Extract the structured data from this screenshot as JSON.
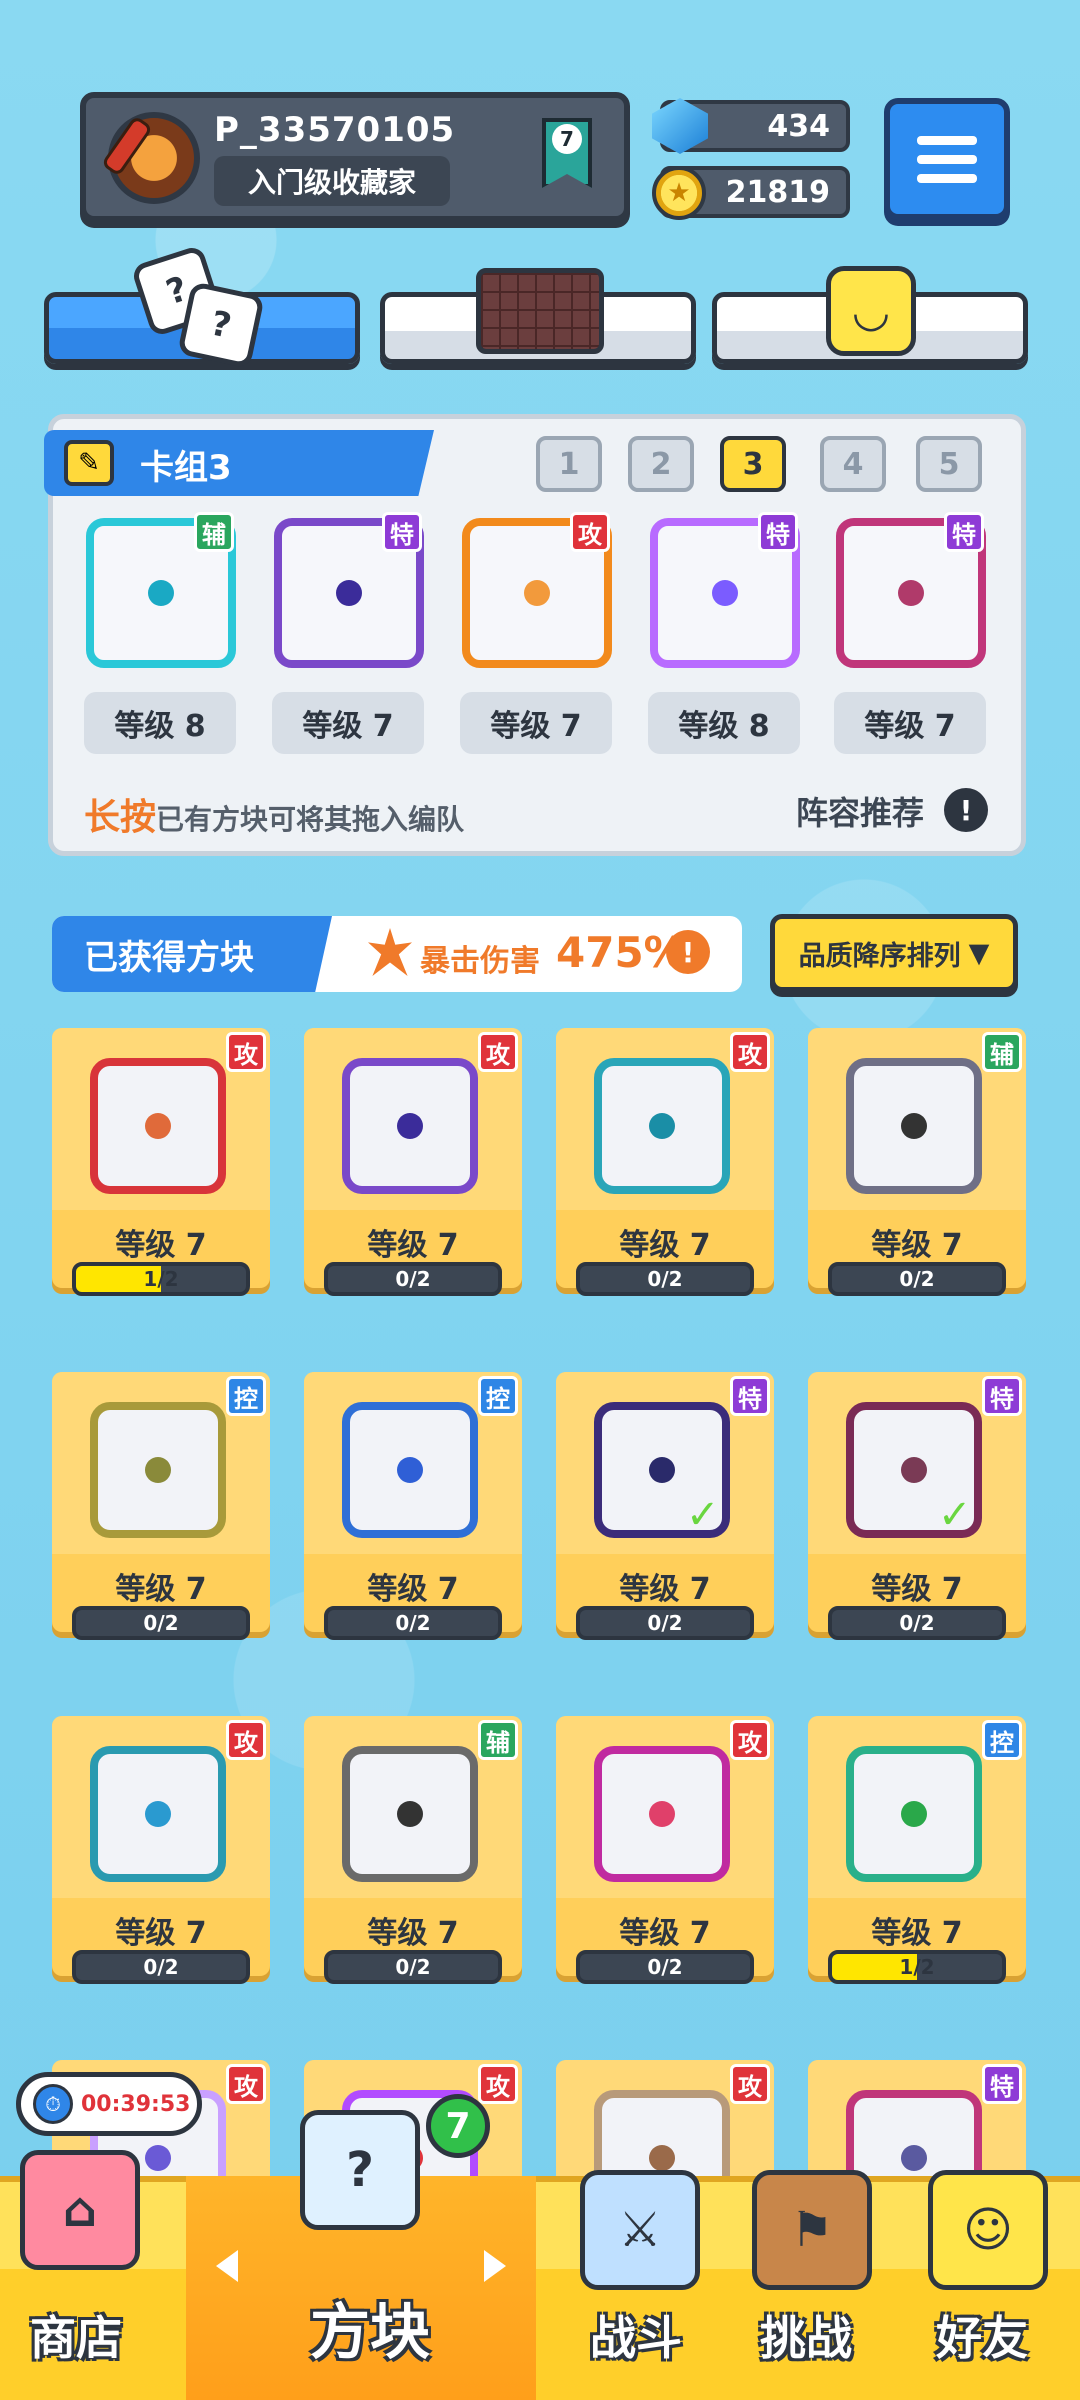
{
  "player": {
    "id": "P_33570105",
    "title": "入门级收藏家",
    "rank": "7"
  },
  "currency": {
    "gems": "434",
    "coins": "21819"
  },
  "deck": {
    "title": "卡组3",
    "numbers": [
      "1",
      "2",
      "3",
      "4",
      "5"
    ],
    "active_number": "3",
    "cards": [
      {
        "tag": "辅",
        "tag_type": "fu",
        "level": "等级 8",
        "color": "#2ac8d8",
        "dot": "#1aa9c4"
      },
      {
        "tag": "特",
        "tag_type": "te",
        "level": "等级 7",
        "color": "#7a49c9",
        "dot": "#3b2c9a"
      },
      {
        "tag": "攻",
        "tag_type": "gong",
        "level": "等级 7",
        "color": "#f28a1c",
        "dot": "#f29a3c"
      },
      {
        "tag": "特",
        "tag_type": "te",
        "level": "等级 8",
        "color": "#b86bff",
        "dot": "#7b5cff"
      },
      {
        "tag": "特",
        "tag_type": "te",
        "level": "等级 7",
        "color": "#c0367a",
        "dot": "#b03a6a"
      }
    ],
    "hint_emphasis": "长按",
    "hint_text": "已有方块可将其拖入编队",
    "lineup_label": "阵容推荐",
    "info_symbol": "!"
  },
  "owned": {
    "title": "已获得方块",
    "crit_label": "暴击伤害",
    "crit_value": "475%",
    "crit_info": "!",
    "sort_label": "品质降序排列",
    "sort_arrow": "▼",
    "cards": [
      {
        "tag": "攻",
        "tag_type": "gong",
        "level": "等级 7",
        "progress": "1/2",
        "fill": 0.5,
        "color": "#d8343a",
        "dot": "#e06a3a",
        "check": false
      },
      {
        "tag": "攻",
        "tag_type": "gong",
        "level": "等级 7",
        "progress": "0/2",
        "fill": 0,
        "color": "#7a49c9",
        "dot": "#3b2c9a",
        "check": false
      },
      {
        "tag": "攻",
        "tag_type": "gong",
        "level": "等级 7",
        "progress": "0/2",
        "fill": 0,
        "color": "#2aa5b8",
        "dot": "#1a8ea6",
        "check": false
      },
      {
        "tag": "辅",
        "tag_type": "fu",
        "level": "等级 7",
        "progress": "0/2",
        "fill": 0,
        "color": "#6f6f86",
        "dot": "#333333",
        "check": false
      },
      {
        "tag": "控",
        "tag_type": "kong",
        "level": "等级 7",
        "progress": "0/2",
        "fill": 0,
        "color": "#a89a3a",
        "dot": "#8a8a3a",
        "check": false
      },
      {
        "tag": "控",
        "tag_type": "kong",
        "level": "等级 7",
        "progress": "0/2",
        "fill": 0,
        "color": "#2f6fd6",
        "dot": "#2f5fd6",
        "check": false
      },
      {
        "tag": "特",
        "tag_type": "te",
        "level": "等级 7",
        "progress": "0/2",
        "fill": 0,
        "color": "#3b2c7a",
        "dot": "#2a2a6a",
        "check": true
      },
      {
        "tag": "特",
        "tag_type": "te",
        "level": "等级 7",
        "progress": "0/2",
        "fill": 0,
        "color": "#7a2a55",
        "dot": "#7a3a55",
        "check": true
      },
      {
        "tag": "攻",
        "tag_type": "gong",
        "level": "等级 7",
        "progress": "0/2",
        "fill": 0,
        "color": "#2a9ab0",
        "dot": "#2a9ad0",
        "check": false
      },
      {
        "tag": "辅",
        "tag_type": "fu",
        "level": "等级 7",
        "progress": "0/2",
        "fill": 0,
        "color": "#6a6a6a",
        "dot": "#333333",
        "check": false
      },
      {
        "tag": "攻",
        "tag_type": "gong",
        "level": "等级 7",
        "progress": "0/2",
        "fill": 0,
        "color": "#c02aa0",
        "dot": "#e0406a",
        "check": false
      },
      {
        "tag": "控",
        "tag_type": "kong",
        "level": "等级 7",
        "progress": "1/2",
        "fill": 0.5,
        "color": "#2ab08a",
        "dot": "#2aa84a",
        "check": false
      },
      {
        "tag": "攻",
        "tag_type": "gong",
        "level": "",
        "progress": "",
        "fill": 0,
        "color": "#c9a0ff",
        "dot": "#6a5ad6",
        "check": false
      },
      {
        "tag": "攻",
        "tag_type": "gong",
        "level": "",
        "progress": "",
        "fill": 0,
        "color": "#b24bff",
        "dot": "#e0333a",
        "check": false
      },
      {
        "tag": "攻",
        "tag_type": "gong",
        "level": "",
        "progress": "",
        "fill": 0,
        "color": "#b89a7a",
        "dot": "#9a6a4a",
        "check": false
      },
      {
        "tag": "特",
        "tag_type": "te",
        "level": "",
        "progress": "",
        "fill": 0,
        "color": "#c0367a",
        "dot": "#5a5aa0",
        "check": false
      }
    ]
  },
  "timer": "00:39:53",
  "box_count": "7",
  "nav": {
    "shop": "商店",
    "blocks": "方块",
    "battle": "战斗",
    "challenge": "挑战",
    "friends": "好友"
  }
}
